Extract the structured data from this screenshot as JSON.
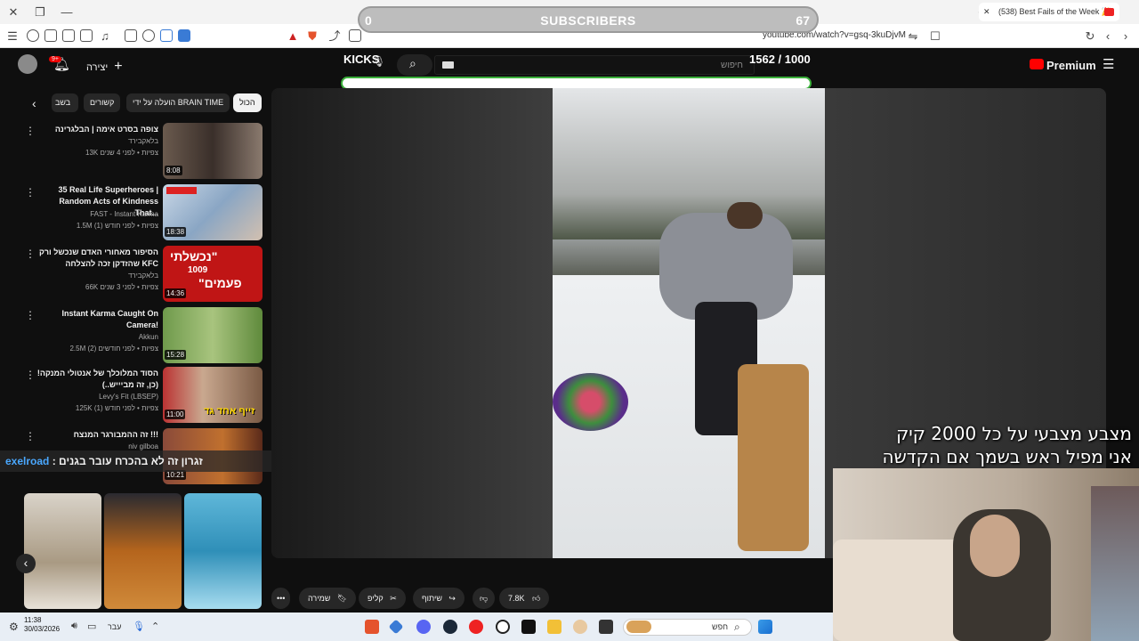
{
  "browser": {
    "tab_title": "(538) Best Fails of the Week 🎉",
    "url": "youtube.com/watch?v=gsq-3kuDjvM"
  },
  "subscribers_goal": {
    "current": "0",
    "label": "SUBSCRIBERS",
    "target": "67"
  },
  "kicks_goal": {
    "label": "KICKS",
    "current": "1562",
    "target": "/ 1000"
  },
  "youtube": {
    "search_placeholder": "חיפוש",
    "create_label": "יצירה",
    "notification_badge": "9+",
    "premium_label": "Premium",
    "chips": [
      "הכול",
      "הועלה על ידי BRAIN TIME",
      "קשורים",
      "בשב"
    ],
    "recommendations": [
      {
        "title": "צופה בסרט אימה | הבלגרינה",
        "channel": "בלאקבירד",
        "meta": "13K צפיות • לפני 4 שנים",
        "duration": "8:08"
      },
      {
        "title": "35 Real Life Superheroes | Random Acts of Kindness That...",
        "channel": "FAST - Instant Karma",
        "meta": "1.5M צפיות • לפני חודש (1)",
        "duration": "18:38"
      },
      {
        "title": "הסיפור מאחורי האדם שנכשל ורק שהזדקן זכה להצלחה KFC",
        "channel": "בלאקבירד",
        "meta": "66K צפיות • לפני 3 שנים",
        "duration": "14:36"
      },
      {
        "title": "Instant Karma Caught On Camera!",
        "channel": "Akkun",
        "meta": "2.5M צפיות • לפני חודשים (2)",
        "duration": "15:28"
      },
      {
        "title": "הסוד המלוכלך של אנטולי המנקה! (כן, זה מביייש..)",
        "channel": "Levy's Fit (LBSEP)",
        "meta": "125K צפיות • לפני חודש (1)",
        "duration": "11:00"
      },
      {
        "title": "זה ההמבורגר המנצח !!!",
        "channel": "niv gilboa",
        "meta": "",
        "duration": "10:21"
      }
    ],
    "thumb_texts": {
      "kfc_line1": "\"נכשלתי",
      "kfc_line2": "1009",
      "kfc_line3": "פעמים\"",
      "levy_caption": "זייף אחד גד"
    },
    "actions": {
      "likes": "7.8K",
      "share": "שיתוף",
      "clip": "קליפ",
      "save": "שמירה",
      "more": "•••"
    }
  },
  "chat": {
    "user": "exelroad",
    "message": ": זגרון זה לא בהכרח עובר בגנים"
  },
  "stream_overlay": {
    "line1": "מצבע מצבעי על כל 2000 קיק",
    "line2": "אני  מפיל ראש בשמך  אם הקדשה"
  },
  "taskbar": {
    "time": "11:38",
    "date": "30/03/2026",
    "lang": "עבר",
    "search_placeholder": "חפש"
  },
  "colors": {
    "youtube_red": "#ff0000",
    "kicks_bar_border": "#3bb03b",
    "chat_user": "#4aa8ff"
  }
}
